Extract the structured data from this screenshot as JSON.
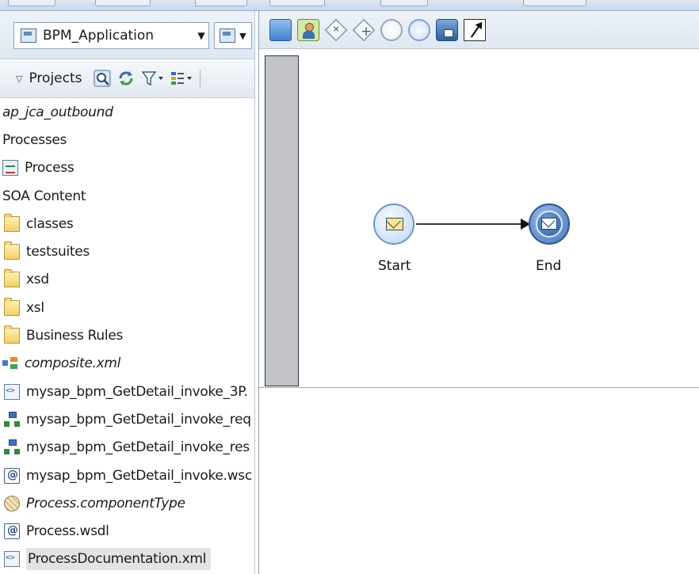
{
  "application": {
    "selector_value": "BPM_Application"
  },
  "projects_panel": {
    "title": "Projects"
  },
  "tree": [
    {
      "label": "ap_jca_outbound",
      "icon": "none",
      "italic": true
    },
    {
      "label": "Processes",
      "icon": "none"
    },
    {
      "label": "Process",
      "icon": "process-icon"
    },
    {
      "label": "SOA Content",
      "icon": "none"
    },
    {
      "label": "classes",
      "icon": "folder-icon"
    },
    {
      "label": "testsuites",
      "icon": "folder-icon"
    },
    {
      "label": "xsd",
      "icon": "folder-icon"
    },
    {
      "label": "xsl",
      "icon": "folder-icon"
    },
    {
      "label": "Business Rules",
      "icon": "folder-icon"
    },
    {
      "label": "composite.xml",
      "icon": "composite-icon",
      "italic": true
    },
    {
      "label": "mysap_bpm_GetDetail_invoke_3P.",
      "icon": "xml-file-icon"
    },
    {
      "label": "mysap_bpm_GetDetail_invoke_req",
      "icon": "schema-icon"
    },
    {
      "label": "mysap_bpm_GetDetail_invoke_res",
      "icon": "schema-icon"
    },
    {
      "label": "mysap_bpm_GetDetail_invoke.wsc",
      "icon": "wsdl-file-icon"
    },
    {
      "label": "Process.componentType",
      "icon": "component-type-icon",
      "italic": true
    },
    {
      "label": "Process.wsdl",
      "icon": "wsdl-file-icon"
    },
    {
      "label": "ProcessDocumentation.xml",
      "icon": "xml-file-icon",
      "selected": true
    }
  ],
  "palette": [
    "activity-icon",
    "user-task-icon",
    "exclusive-gateway-icon",
    "parallel-gateway-icon",
    "start-event-icon",
    "end-event-icon",
    "annotation-icon",
    "flow-connector-icon"
  ],
  "diagram": {
    "start_label": "Start",
    "end_label": "End"
  }
}
